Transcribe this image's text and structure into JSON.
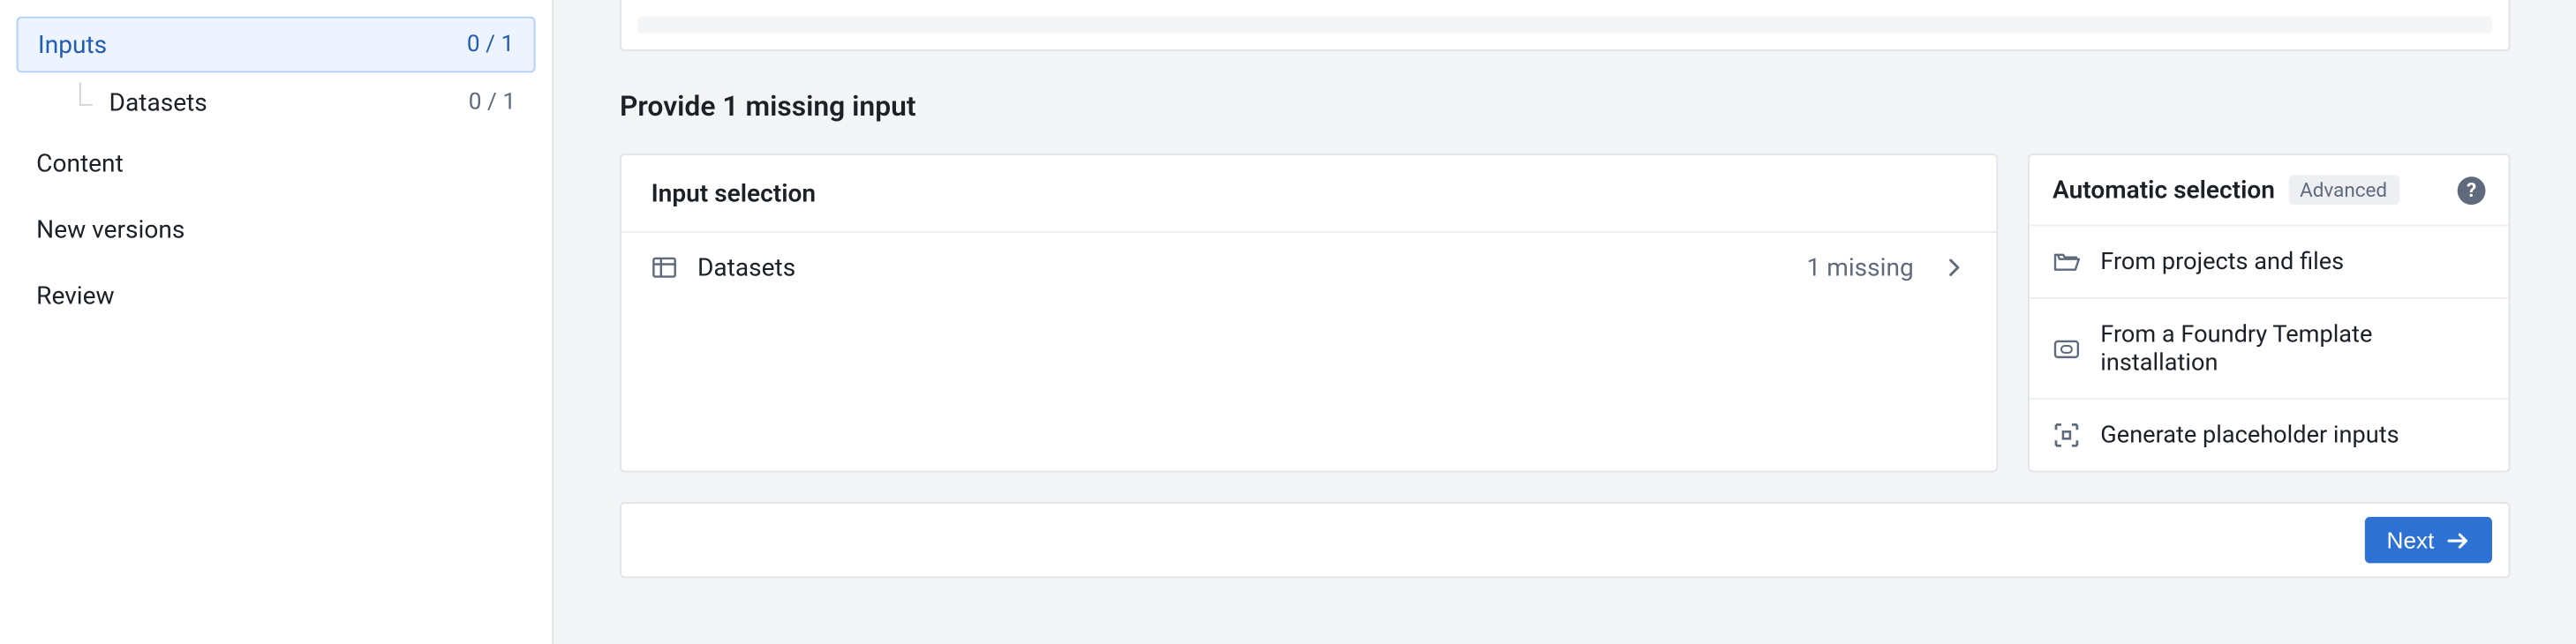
{
  "sidebar": {
    "inputs": {
      "label": "Inputs",
      "count": "0 / 1"
    },
    "datasets": {
      "label": "Datasets",
      "count": "0 / 1"
    },
    "content": "Content",
    "new_versions": "New versions",
    "review": "Review"
  },
  "main": {
    "section_title": "Provide 1 missing input",
    "input_selection": {
      "header": "Input selection",
      "rows": [
        {
          "label": "Datasets",
          "status": "1 missing"
        }
      ]
    },
    "auto_selection": {
      "title": "Automatic selection",
      "badge": "Advanced",
      "items": [
        "From projects and files",
        "From a Foundry Template installation",
        "Generate placeholder inputs"
      ]
    },
    "footer": {
      "next": "Next"
    }
  }
}
